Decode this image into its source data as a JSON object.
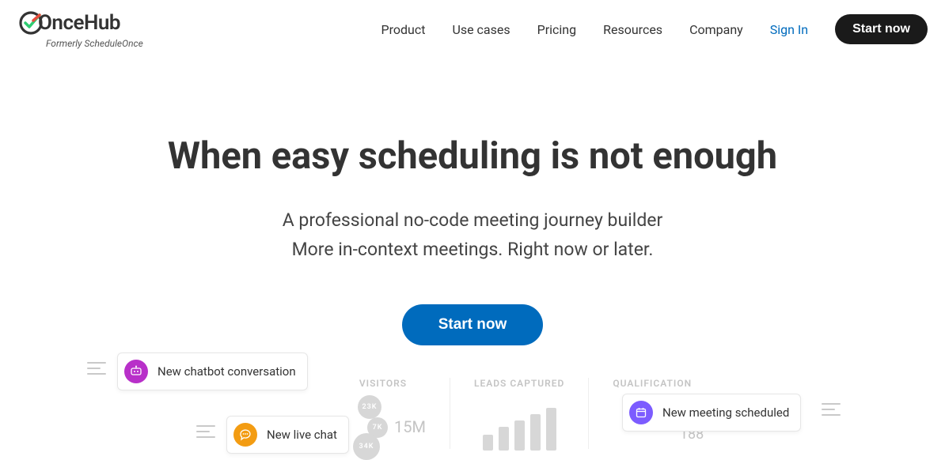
{
  "logo": {
    "name": "OnceHub",
    "sub": "Formerly ScheduleOnce"
  },
  "nav": {
    "items": [
      "Product",
      "Use cases",
      "Pricing",
      "Resources",
      "Company"
    ],
    "signin": "Sign In",
    "cta": "Start now"
  },
  "hero": {
    "headline": "When easy scheduling is not enough",
    "sub1": "A professional no-code meeting journey builder",
    "sub2": "More in-context meetings. Right now or later.",
    "cta": "Start now"
  },
  "pills": {
    "chatbot": "New chatbot conversation",
    "livechat": "New live chat",
    "meeting": "New meeting scheduled"
  },
  "analytics": {
    "visitors": {
      "label": "VISITORS",
      "big": "15M",
      "bubbles": [
        "23K",
        "7K",
        "34K"
      ]
    },
    "leads": {
      "label": "LEADS CAPTURED"
    },
    "qualification": {
      "label": "QUALIFICATION",
      "value": "188"
    }
  }
}
